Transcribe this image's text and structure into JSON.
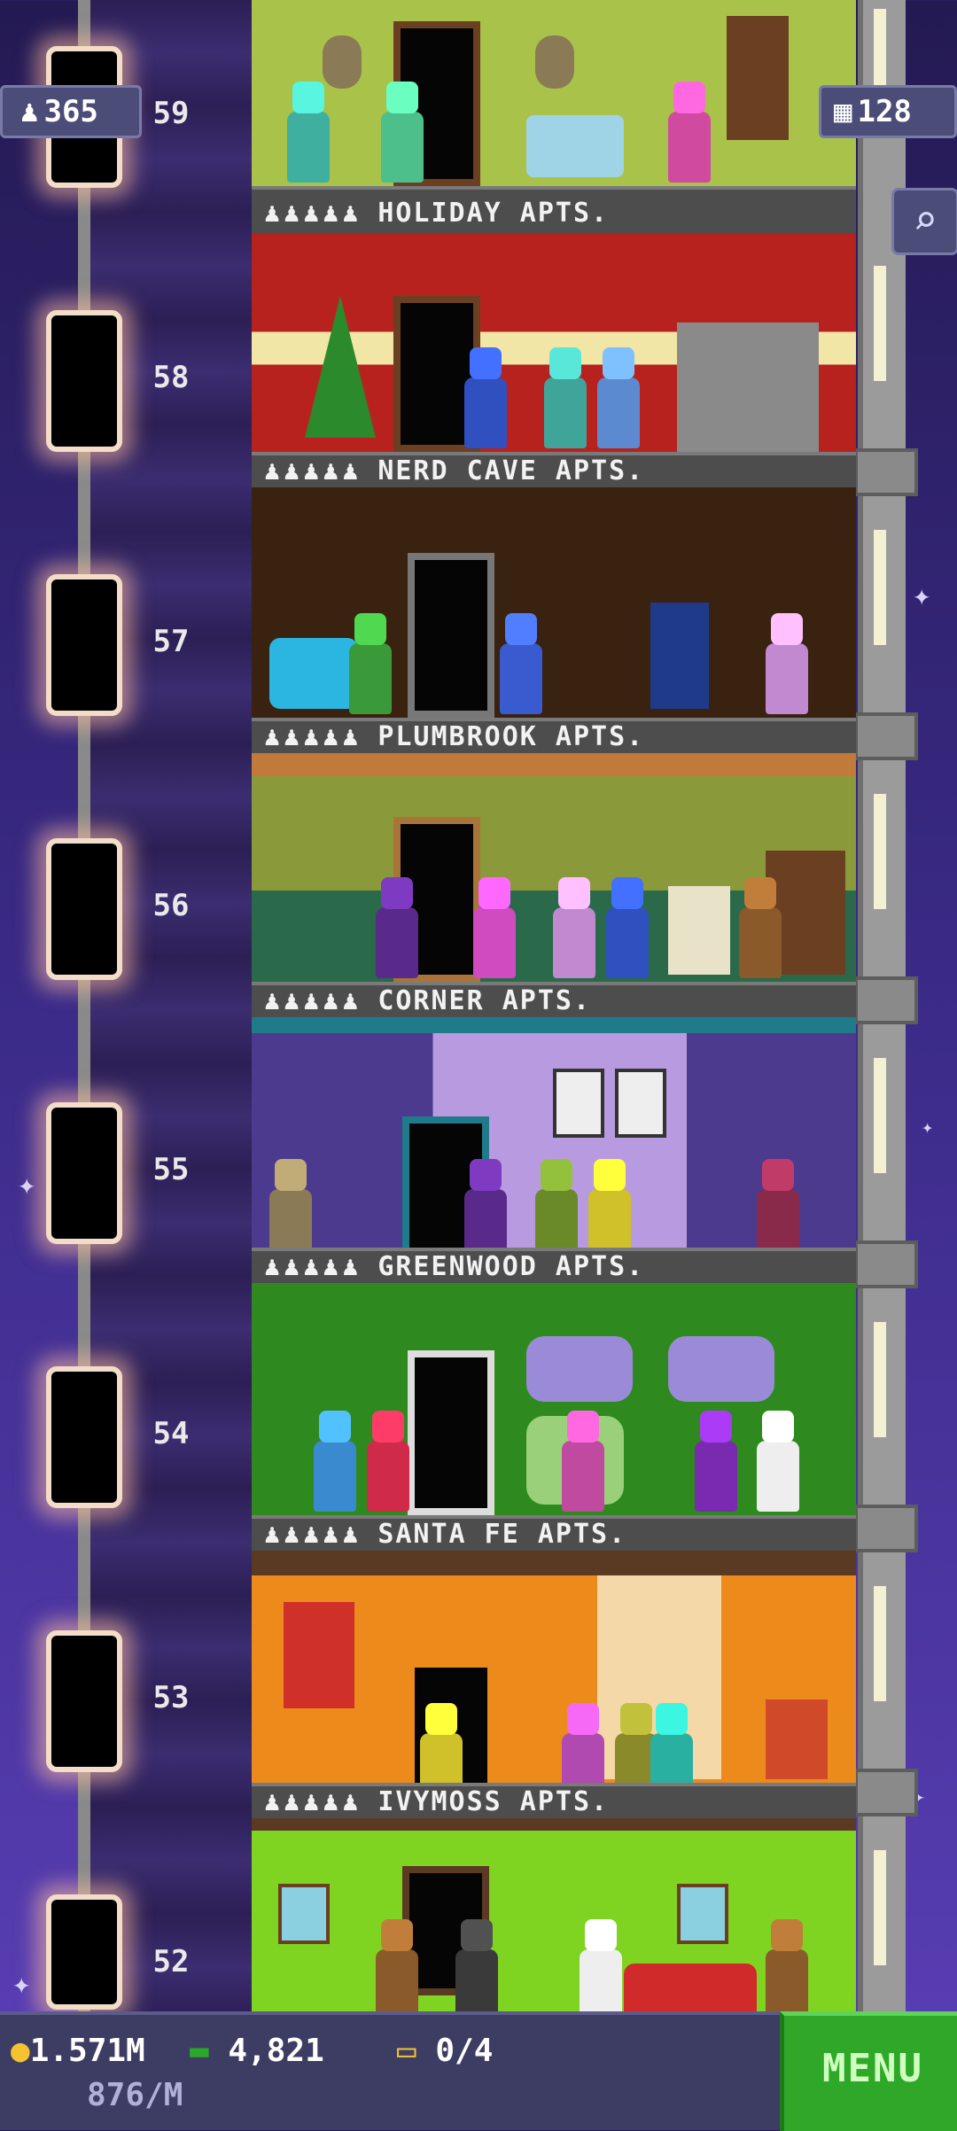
{
  "hud": {
    "population": "365",
    "population_icon": "person-icon",
    "floor_count": "128",
    "floor_icon": "building-icon",
    "search_icon": "magnifier-icon"
  },
  "floors": [
    {
      "number": "59",
      "name": "HOLIDAY APTS.",
      "color": "#a9c24a"
    },
    {
      "number": "58",
      "name": "NERD CAVE APTS.",
      "color": "#b8221e"
    },
    {
      "number": "57",
      "name": "PLUMBROOK APTS.",
      "color": "#3a2210"
    },
    {
      "number": "56",
      "name": "CORNER APTS.",
      "color": "#7c8a3a"
    },
    {
      "number": "55",
      "name": "GREENWOOD APTS.",
      "color": "#4b3a8e"
    },
    {
      "number": "54",
      "name": "SANTA FE APTS.",
      "color": "#2e8a1e"
    },
    {
      "number": "53",
      "name": "IVYMOSS APTS.",
      "color": "#ec8a1c"
    },
    {
      "number": "52",
      "name": "",
      "color": "#7fd321"
    }
  ],
  "status": {
    "coins": "1.571M",
    "coins_rate": "876/M",
    "bux": "4,821",
    "tickets": "0/4"
  },
  "menu_label": "MENU"
}
